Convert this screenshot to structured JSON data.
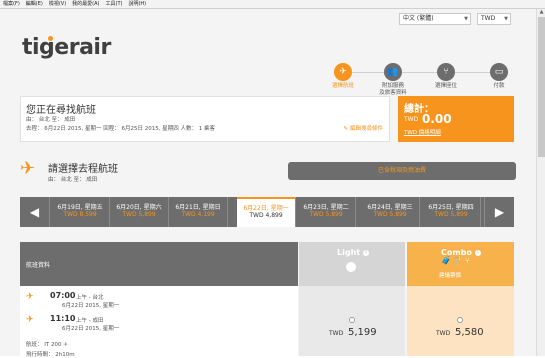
{
  "menubar": [
    "檔案(F)",
    "編輯(E)",
    "檢視(V)",
    "我的最愛(A)",
    "工具(T)",
    "說明(H)"
  ],
  "language": "中文 (繁體)",
  "currency": "TWD",
  "logo": "tigerair",
  "steps": [
    {
      "label": "選擇航班",
      "icon": "plane-icon",
      "active": true
    },
    {
      "label": "附加服務\n及旅客資料",
      "icon": "people-icon",
      "active": false
    },
    {
      "label": "選擇座位",
      "icon": "seat-icon",
      "active": false
    },
    {
      "label": "付款",
      "icon": "payment-icon",
      "active": false
    }
  ],
  "summary": {
    "title": "您正在尋找航班",
    "route": "由： 台北    至： 成田",
    "details": "去程： 6月22日 2015, 星期一    回程： 6月25日 2015, 星期四    人數： 1 乘客",
    "modify": "編輯搜尋條件"
  },
  "total": {
    "label": "總計：",
    "currency": "TWD",
    "amount": "0.00",
    "link": "TWD 價格明細"
  },
  "departure": {
    "title": "請選擇去程航班",
    "route": "由： 台北 至： 成田"
  },
  "all_fares_button": "已含稅項及燃油費",
  "dates": [
    {
      "date": "6月19日, 星期五",
      "price": "TWD 8,599",
      "selected": false
    },
    {
      "date": "6月20日, 星期六",
      "price": "TWD 5,899",
      "selected": false
    },
    {
      "date": "6月21日, 星期日",
      "price": "TWD 4,199",
      "selected": false
    },
    {
      "date": "6月22日, 星期一",
      "price": "TWD 4,899",
      "selected": true
    },
    {
      "date": "6月23日, 星期二",
      "price": "TWD 5,899",
      "selected": false
    },
    {
      "date": "6月24日, 星期三",
      "price": "TWD 5,899",
      "selected": false
    },
    {
      "date": "6月25日, 星期四",
      "price": "TWD 5,899",
      "selected": false
    }
  ],
  "fare_table": {
    "header": "航班資料",
    "light": {
      "name": "Light",
      "currency": "TWD",
      "price": "5,199"
    },
    "combo": {
      "name": "Combo",
      "tag": "建議票價",
      "currency": "TWD",
      "price": "5,580"
    }
  },
  "flight": {
    "dep_time": "07:00",
    "dep_where": "上午 - 台北",
    "dep_date": "6月22日 2015, 星期一",
    "arr_time": "11:10",
    "arr_where": "上午 - 成田",
    "arr_date": "6月22日 2015, 星期一",
    "flight_no": "航班： IT 200",
    "duration": "飛行時間： 2h10m"
  },
  "colors": {
    "accent": "#f7941d",
    "dark": "#6d6d6d",
    "combo": "#f7b24b"
  }
}
